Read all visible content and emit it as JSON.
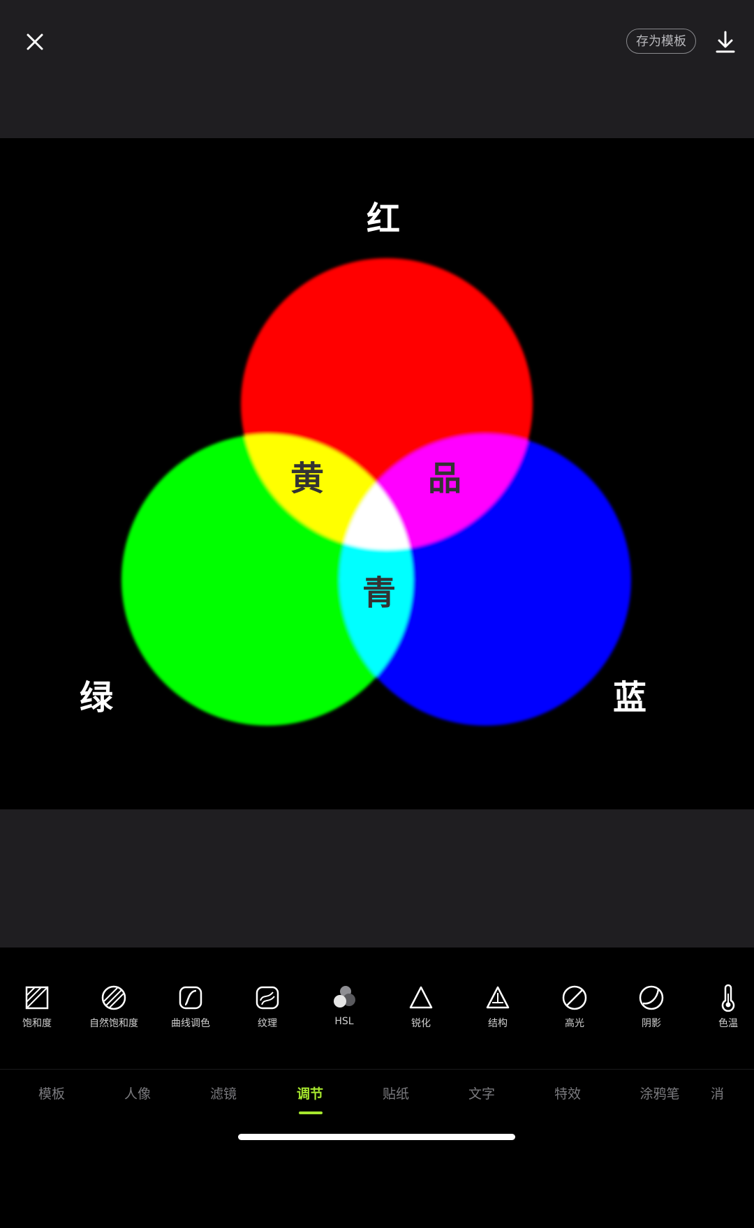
{
  "header": {
    "save_template_label": "存为模板",
    "close_icon": "close-icon",
    "download_icon": "download-icon"
  },
  "canvas_image": {
    "labels": {
      "red": "红",
      "green": "绿",
      "blue": "蓝",
      "yellow": "黄",
      "magenta": "品",
      "cyan": "青"
    },
    "colors": {
      "red": "#ff0000",
      "green": "#00ff00",
      "blue": "#0000ff",
      "yellow": "#ffff00",
      "magenta": "#ff00ff",
      "cyan": "#00ffff",
      "white": "#ffffff"
    }
  },
  "tools": [
    {
      "label": "饱和度",
      "icon": "saturation-icon"
    },
    {
      "label": "自然饱和度",
      "icon": "vibrance-icon"
    },
    {
      "label": "曲线调色",
      "icon": "curves-icon"
    },
    {
      "label": "纹理",
      "icon": "texture-icon"
    },
    {
      "label": "HSL",
      "icon": "hsl-icon"
    },
    {
      "label": "锐化",
      "icon": "sharpen-icon"
    },
    {
      "label": "结构",
      "icon": "structure-icon"
    },
    {
      "label": "高光",
      "icon": "highlight-icon"
    },
    {
      "label": "阴影",
      "icon": "shadow-icon"
    },
    {
      "label": "色温",
      "icon": "temperature-icon"
    }
  ],
  "tabs": [
    {
      "label": "模板"
    },
    {
      "label": "人像"
    },
    {
      "label": "滤镜"
    },
    {
      "label": "调节",
      "active": true
    },
    {
      "label": "贴纸"
    },
    {
      "label": "文字"
    },
    {
      "label": "特效"
    },
    {
      "label": "涂鸦笔"
    },
    {
      "label": "消"
    }
  ],
  "accent_color": "#a6e62e"
}
